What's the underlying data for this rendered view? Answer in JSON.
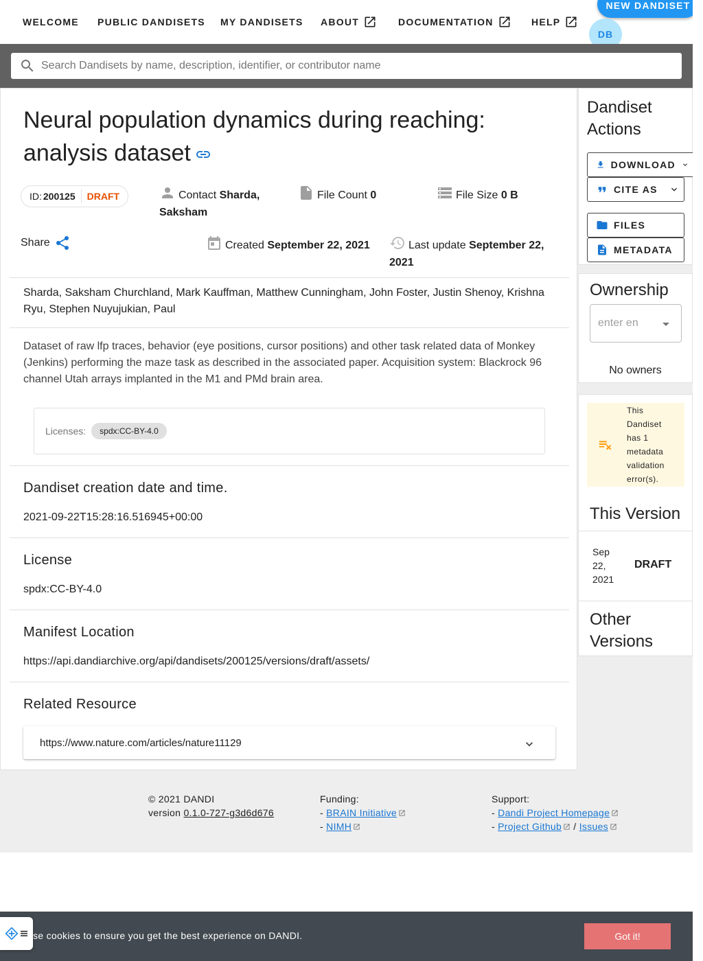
{
  "nav": {
    "items": [
      {
        "label": "WELCOME",
        "external": false
      },
      {
        "label": "PUBLIC DANDISETS",
        "external": false
      },
      {
        "label": "MY DANDISETS",
        "external": false
      },
      {
        "label": "ABOUT",
        "external": true
      },
      {
        "label": "DOCUMENTATION",
        "external": true
      },
      {
        "label": "HELP",
        "external": true
      }
    ],
    "new_dandiset": "NEW DANDISET",
    "avatar_initials": "DB"
  },
  "search": {
    "placeholder": "Search Dandisets by name, description, identifier, or contributor name"
  },
  "dandiset": {
    "title": "Neural population dynamics during reaching: analysis dataset",
    "id_label": "ID:",
    "id": "200125",
    "status": "DRAFT",
    "contact_label": "Contact",
    "contact_name": "Sharda, Saksham",
    "file_count_label": "File Count",
    "file_count": "0",
    "file_size_label": "File Size",
    "file_size": "0 B",
    "share_label": "Share",
    "created_label": "Created",
    "created": "September 22, 2021",
    "updated_label": "Last update",
    "updated": "September 22, 2021",
    "contributors": "Sharda, Saksham Churchland, Mark Kauffman, Matthew Cunningham, John Foster, Justin Shenoy, Krishna Ryu, Stephen Nuyujukian, Paul",
    "description": "Dataset of raw lfp traces, behavior (eye positions, cursor positions) and other task related data of Monkey (Jenkins) performing the maze task as described in the associated paper. Acquisition system: Blackrock 96 channel Utah arrays implanted in the M1 and PMd brain area.",
    "licenses_label": "Licenses:",
    "license_chip": "spdx:CC-BY-4.0"
  },
  "sections": {
    "creation": {
      "heading": "Dandiset creation date and time.",
      "value": "2021-09-22T15:28:16.516945+00:00"
    },
    "license": {
      "heading": "License",
      "value": "spdx:CC-BY-4.0"
    },
    "manifest": {
      "heading": "Manifest Location",
      "value": "https://api.dandiarchive.org/api/dandisets/200125/versions/draft/assets/"
    },
    "related": {
      "heading": "Related Resource",
      "value": "https://www.nature.com/articles/nature11129"
    }
  },
  "sidebar": {
    "actions_heading": "Dandiset Actions",
    "download": "DOWNLOAD",
    "cite": "CITE AS",
    "files": "FILES",
    "metadata": "METADATA",
    "ownership_heading": "Ownership",
    "owner_placeholder": "enter en",
    "no_owners": "No owners",
    "validation_msg": "This Dandiset has 1 metadata validation error(s).",
    "this_version_heading": "This Version",
    "version_date": "Sep 22, 2021",
    "version_status": "DRAFT",
    "other_versions_heading": "Other Versions"
  },
  "footer": {
    "copyright": "© 2021 DANDI",
    "version_label": "version",
    "version": "0.1.0-727-g3d6d676",
    "funding_label": "Funding:",
    "funding_1": "BRAIN Initiative",
    "funding_2": "NIMH",
    "support_label": "Support:",
    "support_1": "Dandi Project Homepage",
    "support_2": "Project Github",
    "support_3": "Issues",
    "dash": "-",
    "slash": "/"
  },
  "cookie": {
    "text": "se cookies to ensure you get the best experience on DANDI.",
    "button": "Got it!"
  },
  "colors": {
    "accent": "#2196f3",
    "link": "#1976d2",
    "draft": "#e65100",
    "warning_bg": "#fff8e1",
    "warning_icon": "#ff9800",
    "search_band": "#616161",
    "cookie_bg": "#424950",
    "cookie_btn": "#e57373"
  }
}
